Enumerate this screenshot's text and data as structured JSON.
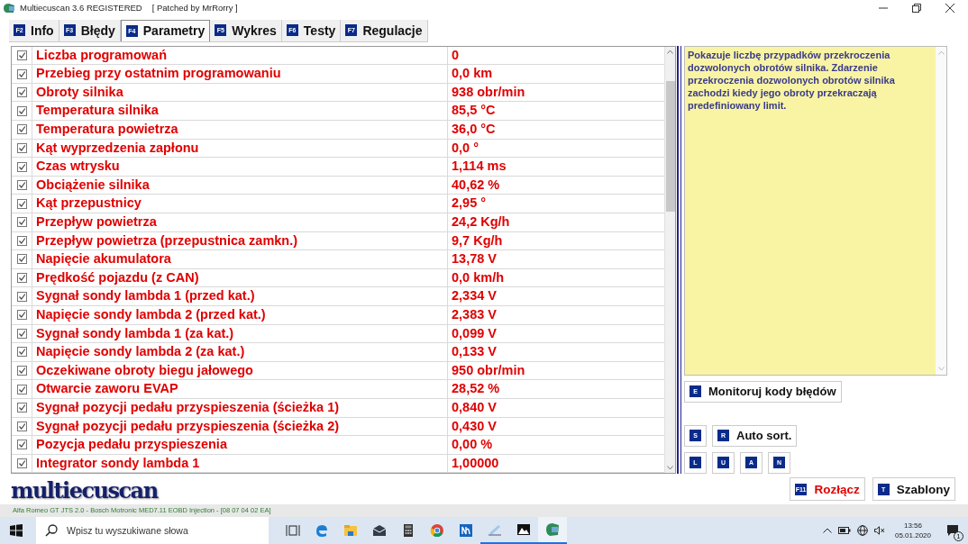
{
  "window": {
    "title": "Multiecuscan 3.6 REGISTERED",
    "subtitle": "[ Patched by MrRorry ]"
  },
  "tabs": [
    {
      "key": "F2",
      "label": "Info",
      "selected": false
    },
    {
      "key": "F3",
      "label": "Błędy",
      "selected": false
    },
    {
      "key": "F4",
      "label": "Parametry",
      "selected": true
    },
    {
      "key": "F5",
      "label": "Wykres",
      "selected": false
    },
    {
      "key": "F6",
      "label": "Testy",
      "selected": false
    },
    {
      "key": "F7",
      "label": "Regulacje",
      "selected": false
    }
  ],
  "parameters": [
    {
      "name": "Liczba programowań",
      "value": "0",
      "checked": true
    },
    {
      "name": "Przebieg przy ostatnim programowaniu",
      "value": "0,0 km",
      "checked": true
    },
    {
      "name": "Obroty silnika",
      "value": "938 obr/min",
      "checked": true
    },
    {
      "name": "Temperatura silnika",
      "value": "85,5 °C",
      "checked": true
    },
    {
      "name": "Temperatura powietrza",
      "value": "36,0 °C",
      "checked": true
    },
    {
      "name": "Kąt wyprzedzenia zapłonu",
      "value": "0,0 °",
      "checked": true
    },
    {
      "name": "Czas wtrysku",
      "value": "1,114 ms",
      "checked": true
    },
    {
      "name": "Obciążenie silnika",
      "value": "40,62 %",
      "checked": true
    },
    {
      "name": "Kąt przepustnicy",
      "value": "2,95 °",
      "checked": true
    },
    {
      "name": "Przepływ powietrza",
      "value": "24,2 Kg/h",
      "checked": true
    },
    {
      "name": "Przepływ powietrza (przepustnica zamkn.)",
      "value": "9,7 Kg/h",
      "checked": true
    },
    {
      "name": "Napięcie akumulatora",
      "value": "13,78 V",
      "checked": true
    },
    {
      "name": "Prędkość pojazdu (z CAN)",
      "value": "0,0 km/h",
      "checked": true
    },
    {
      "name": "Sygnał sondy lambda 1 (przed kat.)",
      "value": "2,334 V",
      "checked": true
    },
    {
      "name": "Napięcie sondy lambda 2 (przed kat.)",
      "value": "2,383 V",
      "checked": true
    },
    {
      "name": "Sygnał sondy lambda 1 (za kat.)",
      "value": "0,099 V",
      "checked": true
    },
    {
      "name": "Napięcie sondy lambda 2 (za kat.)",
      "value": "0,133 V",
      "checked": true
    },
    {
      "name": "Oczekiwane obroty biegu jałowego",
      "value": "950 obr/min",
      "checked": true
    },
    {
      "name": "Otwarcie zaworu EVAP",
      "value": "28,52 %",
      "checked": true
    },
    {
      "name": "Sygnał pozycji pedału przyspieszenia (ścieżka 1)",
      "value": "0,840 V",
      "checked": true
    },
    {
      "name": "Sygnał pozycji pedału przyspieszenia (ścieżka 2)",
      "value": "0,430 V",
      "checked": true
    },
    {
      "name": "Pozycja pedału przyspieszenia",
      "value": "0,00 %",
      "checked": true
    },
    {
      "name": "Integrator sondy lambda 1",
      "value": "1,00000",
      "checked": true
    }
  ],
  "description": "Pokazuje liczbę przypadków przekroczenia dozwolonych obrotów silnika. Zdarzenie przekroczenia dozwolonych obrotów silnika zachodzi kiedy jego obroty przekraczają predefiniowany limit.",
  "monitor_button": {
    "key": "E",
    "label": "Monitoruj kody błędów"
  },
  "sort_buttons": [
    {
      "key": "S"
    },
    {
      "key": "R",
      "label": "Auto sort."
    }
  ],
  "letter_buttons": [
    {
      "key": "L"
    },
    {
      "key": "U"
    },
    {
      "key": "A"
    },
    {
      "key": "N"
    }
  ],
  "bottom_buttons": [
    {
      "key": "F11",
      "label": "Rozłącz",
      "kind": "danger"
    },
    {
      "key": "T",
      "label": "Szablony",
      "kind": "normal"
    }
  ],
  "logo": "multiecuscan",
  "status_bar": "Alfa Romeo GT JTS 2.0 - Bosch Motronic MED7.11 EOBD Injection - [08 07 04 02 EA]",
  "taskbar": {
    "search_placeholder": "Wpisz tu wyszukiwane słowa",
    "time": "13:56",
    "date": "05.01.2020",
    "notifications": "1"
  }
}
